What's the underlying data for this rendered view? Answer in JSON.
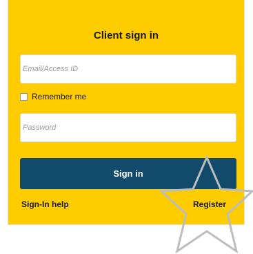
{
  "form": {
    "title": "Client sign in",
    "email_placeholder": "Email/Access ID",
    "remember_label": "Remember me",
    "password_placeholder": "Password",
    "signin_label": "Sign in",
    "help_link": "Sign-In help",
    "register_link": "Register"
  },
  "colors": {
    "panel_background": "#ffcc00",
    "button_background": "#124a6b",
    "button_text": "#ffffff"
  },
  "overlay": {
    "icon": "star-outline-icon"
  }
}
